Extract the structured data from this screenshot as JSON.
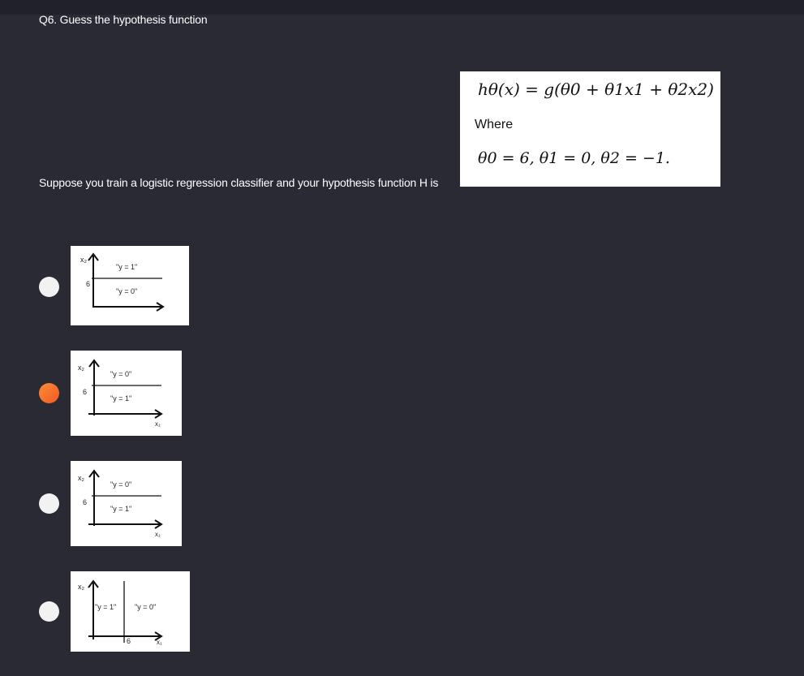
{
  "question": {
    "title": "Q6. Guess the hypothesis function",
    "prompt": "Suppose you train a logistic regression classifier and your hypothesis function H is"
  },
  "formula": {
    "hypothesis": "hθ(x) = g(θ0 + θ1x1 + θ2x2)",
    "where": "Where",
    "params": "θ0 = 6, θ1 = 0, θ2 = −1."
  },
  "options": [
    {
      "selected": false,
      "labels": {
        "x_axis_var": "x₂",
        "tick": "6",
        "above": "\"y = 1\"",
        "below": "\"y = 0\""
      }
    },
    {
      "selected": true,
      "labels": {
        "x_axis_var": "x₂",
        "tick": "6",
        "above": "\"y = 0\"",
        "below": "\"y = 1\"",
        "h_axis_var": "x₁"
      }
    },
    {
      "selected": false,
      "labels": {
        "x_axis_var": "x₂",
        "tick": "6",
        "above": "\"y = 0\"",
        "below": "\"y = 1\"",
        "h_axis_var": "x₁"
      }
    },
    {
      "selected": false,
      "labels": {
        "x_axis_var": "x₂",
        "tick": "6",
        "left": "\"y = 1\"",
        "right": "\"y = 0\"",
        "h_axis_var": "x₁"
      }
    }
  ],
  "colors": {
    "background": "#292a33",
    "radio_unselected": "#f2f2f2",
    "radio_selected": "#f26b2a"
  }
}
